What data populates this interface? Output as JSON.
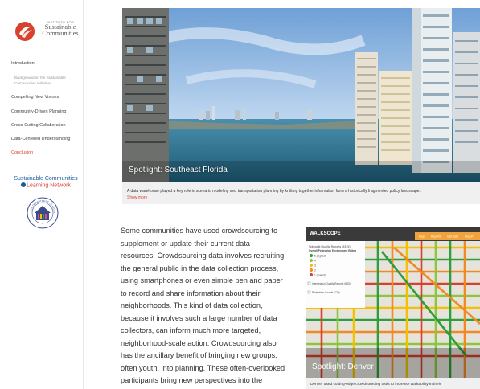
{
  "sidebar": {
    "logo": {
      "small": "INSTITUTE FOR",
      "line1": "Sustainable",
      "line2": "Communities"
    },
    "nav": [
      {
        "label": "Introduction"
      },
      {
        "label": "Background on the Sustainable Communities Initiative",
        "sub": true
      },
      {
        "label": "Compelling New Visions"
      },
      {
        "label": "Community-Driven Planning"
      },
      {
        "label": "Cross-Cutting Collaboration"
      },
      {
        "label": "Data-Centered Understanding"
      },
      {
        "label": "Conclusion",
        "active": true
      }
    ],
    "network": {
      "line1": "Sustainable Communities",
      "line2": "Learning Network"
    },
    "seal": {
      "text": "U.S. DEPARTMENT OF HOUSING AND URBAN DEVELOPMENT"
    }
  },
  "hero": {
    "spotlight_title": "Spotlight: Southeast Florida",
    "caption": "A data warehouse played a key role in scenario modeling and transportation planning by knitting together information from a historically fragmented policy landscape.",
    "show_more": "Show more"
  },
  "article": {
    "lines": [
      "Some communities have used crowdsourcing to",
      "supplement or update their current data",
      "resources. Crowdsourcing data involves recruiting",
      "the general public in the data collection process,",
      "using smartphones or even simple pen and paper",
      "to record and share information about their",
      "neighborhoods. This kind of data collection,",
      "because it involves such a large number of data",
      "collectors, can inform much more targeted,",
      "neighborhood-scale action. Crowdsourcing also",
      "has the ancillary benefit of bringing new groups,",
      "often youth, into planning. These often-overlooked",
      "participants bring new perspectives into the"
    ]
  },
  "map": {
    "brand": "WALKSCOPE",
    "menu": [
      "Map",
      "Reports",
      "Get Data",
      "Report"
    ],
    "legend_title": "Sidewalk Quality Reports (5315)",
    "legend_sub": "Overall Pedestrian Environment Rating",
    "legend_items": [
      {
        "label": "5 (highest)",
        "color": "#2e9d3a"
      },
      {
        "label": "4",
        "color": "#8cc63f"
      },
      {
        "label": "3",
        "color": "#f2c200"
      },
      {
        "label": "2",
        "color": "#f08a24"
      },
      {
        "label": "1 (lowest)",
        "color": "#d9412f"
      }
    ],
    "intersection_label": "Intersection Quality Reports (883)",
    "pedestrian_label": "Pedestrian Counts (179)",
    "spotlight_title": "Spotlight: Denver",
    "caption": "Denver used cutting-edge crowdsourcing tools to increase walkability in their"
  },
  "colors": {
    "accent": "#d9412f",
    "link_blue": "#1a5c9a",
    "caption_bg": "#f0f0f0"
  }
}
